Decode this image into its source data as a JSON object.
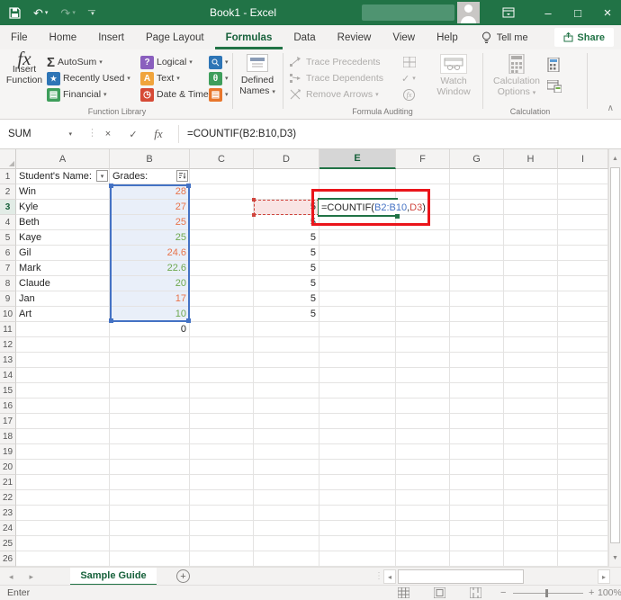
{
  "colors": {
    "excel_green": "#217346",
    "ref_blue": "#4472C4",
    "ref_blue_fill": "#E9EFF9",
    "ref_red": "#D0453E",
    "ref_red_fill": "#F9E4E4",
    "annotation_red": "#EA151B",
    "grade_orange": "#E8734A",
    "grade_green": "#6EA84F"
  },
  "icon_colors": {
    "blue": "#2E75B6",
    "green": "#3E9E5B",
    "purple": "#8A5FBE",
    "yellow": "#F0A43C",
    "red": "#D64A36",
    "orange": "#E8762C"
  },
  "icons": {
    "caret": "▾",
    "sigma": "Σ",
    "star": "★",
    "book": "▤",
    "question": "?",
    "letter_a": "A",
    "clock": "◷",
    "theta": "θ",
    "fx": "fx",
    "check": "✓",
    "cancel": "×",
    "select_all": "◢",
    "up": "▲",
    "down": "▼",
    "left": "◂",
    "right": "▸",
    "undo": "↶",
    "redo": "↷",
    "minimize": "–",
    "maximize": "□",
    "close": "×",
    "plus": "+",
    "minus": "−",
    "collapse": "∧",
    "dots": "⋮"
  },
  "title_bar": {
    "title": "Book1 - Excel"
  },
  "menu": {
    "tabs": [
      "File",
      "Home",
      "Insert",
      "Page Layout",
      "Formulas",
      "Data",
      "Review",
      "View",
      "Help"
    ],
    "active_tab": "Formulas",
    "tell_me": "Tell me",
    "share": "Share"
  },
  "ribbon": {
    "function_library": {
      "group_label": "Function Library",
      "insert_function_line1": "Insert",
      "insert_function_line2": "Function",
      "col1": [
        {
          "label": "AutoSum"
        },
        {
          "label": "Recently Used"
        },
        {
          "label": "Financial"
        }
      ],
      "col2": [
        {
          "label": "Logical"
        },
        {
          "label": "Text"
        },
        {
          "label": "Date & Time"
        }
      ]
    },
    "defined_names": {
      "line1": "Defined",
      "line2": "Names"
    },
    "formula_auditing": {
      "group_label": "Formula Auditing",
      "items": [
        {
          "label": "Trace Precedents"
        },
        {
          "label": "Trace Dependents"
        },
        {
          "label": "Remove Arrows"
        }
      ],
      "watch_line1": "Watch",
      "watch_line2": "Window"
    },
    "calculation": {
      "group_label": "Calculation",
      "options_line1": "Calculation",
      "options_line2": "Options"
    }
  },
  "formula_bar": {
    "name_box": "SUM",
    "formula": "=COUNTIF(B2:B10,D3)"
  },
  "edit_cell": {
    "cell": "E3",
    "prefix": "=COUNTIF(",
    "ref1": "B2:B10",
    "comma": ",",
    "ref2": "D3",
    "suffix": ")"
  },
  "selection": {
    "blue_range": "B2:B10",
    "red_cell": "D3",
    "edit_cell": "E3"
  },
  "grid": {
    "columns": [
      "A",
      "B",
      "C",
      "D",
      "E",
      "F",
      "G",
      "H",
      "I"
    ],
    "row_count": 26,
    "active_col": "E",
    "active_row": 3,
    "cells": {
      "A1": {
        "t": "Student's Name:",
        "f": "dropdown"
      },
      "B1": {
        "t": "Grades:",
        "f": "sort"
      },
      "A2": {
        "t": "Win"
      },
      "B2": {
        "t": "28",
        "c": "orange"
      },
      "A3": {
        "t": "Kyle"
      },
      "B3": {
        "t": "27",
        "c": "orange"
      },
      "A4": {
        "t": "Beth"
      },
      "B4": {
        "t": "25",
        "c": "orange"
      },
      "A5": {
        "t": "Kaye"
      },
      "B5": {
        "t": "25",
        "c": "green"
      },
      "A6": {
        "t": "Gil"
      },
      "B6": {
        "t": "24.6",
        "c": "orange"
      },
      "A7": {
        "t": "Mark"
      },
      "B7": {
        "t": "22.6",
        "c": "green"
      },
      "A8": {
        "t": "Claude"
      },
      "B8": {
        "t": "20",
        "c": "green"
      },
      "A9": {
        "t": "Jan"
      },
      "B9": {
        "t": "17",
        "c": "orange"
      },
      "A10": {
        "t": "Art"
      },
      "B10": {
        "t": "10",
        "c": "green"
      },
      "B11": {
        "t": "0"
      },
      "D3": {
        "t": "5"
      },
      "D4": {
        "t": "5"
      },
      "D5": {
        "t": "5"
      },
      "D6": {
        "t": "5"
      },
      "D7": {
        "t": "5"
      },
      "D8": {
        "t": "5"
      },
      "D9": {
        "t": "5"
      },
      "D10": {
        "t": "5"
      }
    }
  },
  "sheet_tabs": {
    "active": "Sample Guide"
  },
  "status_bar": {
    "mode": "Enter",
    "zoom_level": "100%"
  }
}
